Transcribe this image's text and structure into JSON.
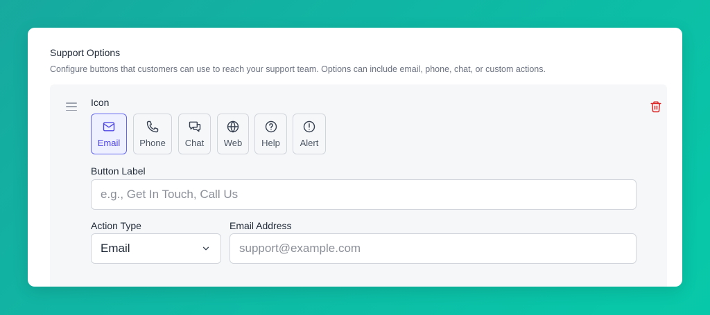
{
  "section": {
    "title": "Support Options",
    "description": "Configure buttons that customers can use to reach your support team. Options can include email, phone, chat, or custom actions."
  },
  "option": {
    "icon_label": "Icon",
    "icons": [
      {
        "label": "Email",
        "icon": "mail-icon",
        "selected": true
      },
      {
        "label": "Phone",
        "icon": "phone-icon",
        "selected": false
      },
      {
        "label": "Chat",
        "icon": "chat-icon",
        "selected": false
      },
      {
        "label": "Web",
        "icon": "globe-icon",
        "selected": false
      },
      {
        "label": "Help",
        "icon": "help-icon",
        "selected": false
      },
      {
        "label": "Alert",
        "icon": "alert-icon",
        "selected": false
      }
    ],
    "button_label": {
      "label": "Button Label",
      "value": "",
      "placeholder": "e.g., Get In Touch, Call Us"
    },
    "action_type": {
      "label": "Action Type",
      "value": "Email"
    },
    "email_address": {
      "label": "Email Address",
      "value": "",
      "placeholder": "support@example.com"
    }
  },
  "colors": {
    "accent": "#6366f1",
    "danger": "#dc2626",
    "background_gradient": [
      "#17a99f",
      "#07c9a9"
    ]
  }
}
